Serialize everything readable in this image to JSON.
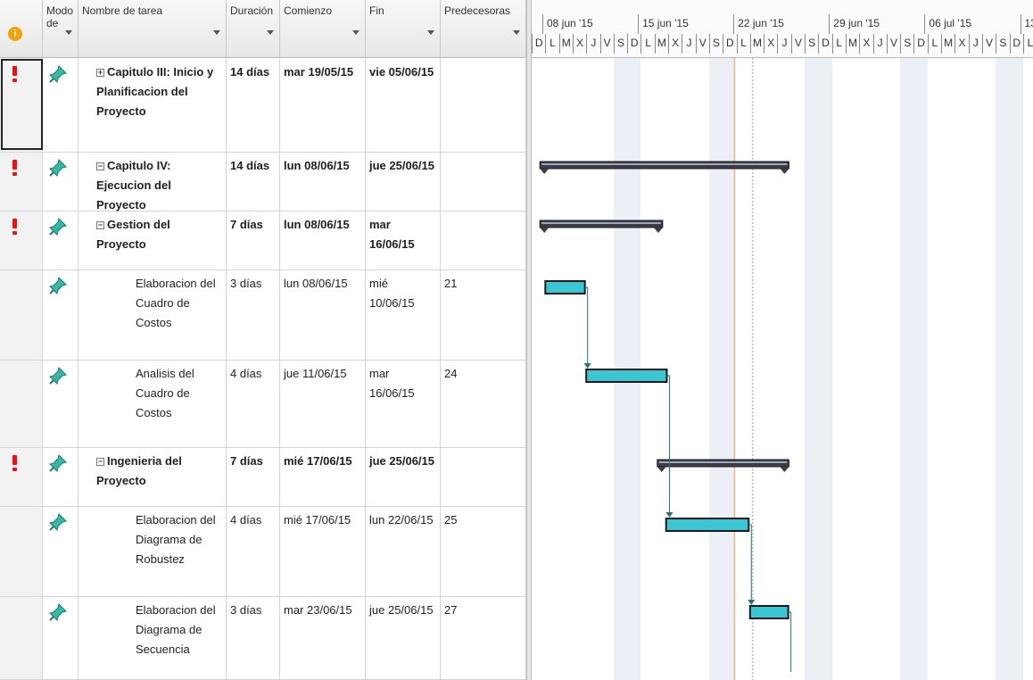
{
  "columns": {
    "info": "i",
    "mode": "Modo de",
    "name": "Nombre de tarea",
    "duration": "Duración",
    "start": "Comienzo",
    "end": "Fin",
    "predecessors": "Predecesoras"
  },
  "tasks": [
    {
      "name": "Capitulo III: Inicio y Planificacion del Proyecto",
      "toggle": "+",
      "duration": "14 días",
      "start": "mar 19/05/15",
      "end": "vie 05/06/15",
      "pred": "",
      "summary": true,
      "alert": true
    },
    {
      "name": "Capitulo IV: Ejecucion del Proyecto",
      "toggle": "−",
      "duration": "14 días",
      "start": "lun 08/06/15",
      "end": "jue 25/06/15",
      "pred": "",
      "summary": true,
      "alert": true
    },
    {
      "name": "Gestion del Proyecto",
      "toggle": "−",
      "duration": "7 días",
      "start": "lun 08/06/15",
      "end": "mar 16/06/15",
      "pred": "",
      "summary": true,
      "alert": true
    },
    {
      "name": "Elaboracion del Cuadro de Costos",
      "toggle": "",
      "duration": "3 días",
      "start": "lun 08/06/15",
      "end": "mié 10/06/15",
      "pred": "21",
      "summary": false,
      "alert": false
    },
    {
      "name": "Analisis del Cuadro de Costos",
      "toggle": "",
      "duration": "4 días",
      "start": "jue 11/06/15",
      "end": "mar 16/06/15",
      "pred": "24",
      "summary": false,
      "alert": false
    },
    {
      "name": "Ingenieria del Proyecto",
      "toggle": "−",
      "duration": "7 días",
      "start": "mié 17/06/15",
      "end": "jue 25/06/15",
      "pred": "",
      "summary": true,
      "alert": true
    },
    {
      "name": "Elaboracion del Diagrama de Robustez",
      "toggle": "",
      "duration": "4 días",
      "start": "mié 17/06/15",
      "end": "lun 22/06/15",
      "pred": "25",
      "summary": false,
      "alert": false
    },
    {
      "name": "Elaboracion del Diagrama de Secuencia",
      "toggle": "",
      "duration": "3 días",
      "start": "mar 23/06/15",
      "end": "jue 25/06/15",
      "pred": "27",
      "summary": false,
      "alert": false
    }
  ],
  "timeline": {
    "weeks": [
      "08 jun '15",
      "15 jun '15",
      "22 jun '15",
      "29 jun '15",
      "06 jul '15",
      "13"
    ],
    "day_letters": [
      "D",
      "L",
      "M",
      "X",
      "J",
      "V",
      "S"
    ],
    "colors": {
      "summary_bar": "#3c3c44",
      "task_bar": "#3cc6d4",
      "link": "#2a6f73",
      "today_line": "#f0a050"
    }
  }
}
